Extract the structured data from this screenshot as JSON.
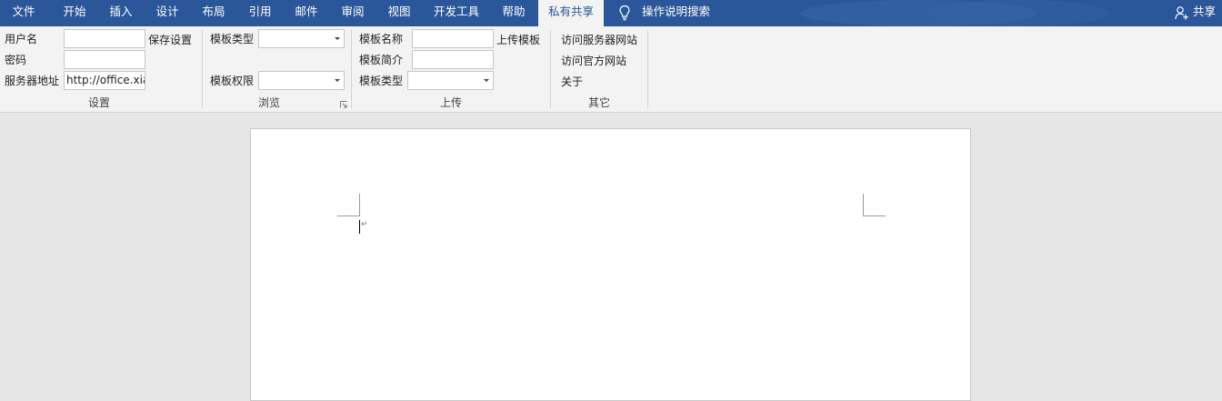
{
  "tabs": [
    "文件",
    "开始",
    "插入",
    "设计",
    "布局",
    "引用",
    "邮件",
    "审阅",
    "视图",
    "开发工具",
    "帮助",
    "私有共享"
  ],
  "active_tab": "私有共享",
  "tell_me": "操作说明搜索",
  "share": "共享",
  "settings": {
    "username_label": "用户名",
    "password_label": "密码",
    "server_label": "服务器地址",
    "server_value": "http://office.xia",
    "save_button": "保存设置",
    "group_label": "设置"
  },
  "browse": {
    "template_type_label": "模板类型",
    "template_perm_label": "模板权限",
    "group_label": "浏览"
  },
  "upload": {
    "name_label": "模板名称",
    "intro_label": "模板简介",
    "type_label": "模板类型",
    "upload_button": "上传模板",
    "group_label": "上传"
  },
  "other": {
    "visit_server": "访问服务器网站",
    "visit_official": "访问官方网站",
    "about": "关于",
    "group_label": "其它"
  },
  "colors": {
    "titlebar": "#2b579a",
    "ribbon": "#f3f3f3",
    "workspace": "#e6e6e6",
    "page": "#ffffff"
  },
  "icons": {
    "tell_me": "lightbulb-icon",
    "share": "person-add-icon",
    "launcher": "dialog-launcher-icon",
    "paragraph": "paragraph-mark-icon"
  }
}
